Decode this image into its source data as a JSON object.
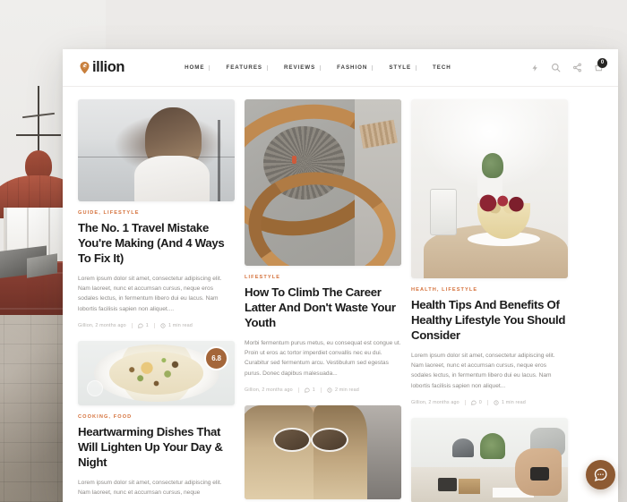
{
  "site": {
    "logo_text": "illion",
    "logo_mark": "g-pin-icon"
  },
  "nav": {
    "items": [
      {
        "label": "HOME"
      },
      {
        "label": "FEATURES"
      },
      {
        "label": "REVIEWS"
      },
      {
        "label": "FASHION"
      },
      {
        "label": "STYLE"
      },
      {
        "label": "TECH"
      }
    ]
  },
  "header_icons": {
    "flash": "lightning-icon",
    "search": "search-icon",
    "share": "share-icon",
    "cart": "cart-icon",
    "cart_count": "0"
  },
  "accent_colors": {
    "category": "#d4703a",
    "rating_badge": "#a4663a",
    "chat_fab": "#8d5a32",
    "logo_mark": "#c87f3c",
    "cart_badge": "#262523"
  },
  "posts": [
    {
      "id": "travel-mistake",
      "categories": "GUIDE, LIFESTYLE",
      "title": "The No. 1 Travel Mistake You're Making (And 4 Ways To Fix It)",
      "excerpt": "Lorem ipsum dolor sit amet, consectetur adipiscing elit. Nam laoreet, nunc et accumsan cursus, neque eros sodales lectus, in fermentum libero dui eu lacus. Nam lobortis facilisis sapien non aliquet....",
      "author_date": "Gillion, 2 months ago",
      "comments": "1",
      "read_time": "1 min read",
      "image": "woman-waterfront-photo"
    },
    {
      "id": "heartwarming-dishes",
      "categories": "COOKING, FOOD",
      "title": "Heartwarming Dishes That Will Lighten Up Your Day & Night",
      "excerpt": "Lorem ipsum dolor sit amet, consectetur adipiscing elit. Nam laoreet, nunc et accumsan cursus, neque",
      "rating": "6.8",
      "image": "risotto-bowl-photo"
    },
    {
      "id": "climb-career-latter",
      "categories": "LIFESTYLE",
      "title": "How To Climb The Career Latter And Don't Waste Your Youth",
      "excerpt": "Morbi fermentum purus metus, eu consequat est congue ut. Proin ut eros ac tortor imperdiet convallis nec eu dui. Curabitur sed fermentum arcu. Vestibulum sed egestas purus. Donec dapibus malesuada...",
      "author_date": "Gillion, 2 months ago",
      "comments": "1",
      "read_time": "2 min read",
      "image": "spiral-staircase-photo"
    },
    {
      "id": "sunglasses-post",
      "image": "woman-sunglasses-photo"
    },
    {
      "id": "health-tips",
      "categories": "HEALTH, LIFESTYLE",
      "title": "Health Tips And Benefits Of Healthy Lifestyle You Should Consider",
      "excerpt": "Lorem ipsum dolor sit amet, consectetur adipiscing elit. Nam laoreet, nunc et accumsan cursus, neque eros sodales lectus, in fermentum libero dui eu lacus. Nam lobortis facilisis sapien non aliquet...",
      "author_date": "Gillion, 2 months ago",
      "comments": "0",
      "read_time": "1 min read",
      "image": "fruit-bowl-table-photo"
    },
    {
      "id": "desk-post",
      "image": "desk-workspace-photo"
    }
  ],
  "chat_fab": {
    "icon": "chat-bubble-icon"
  },
  "background": {
    "image": "lighthouse-photo"
  }
}
